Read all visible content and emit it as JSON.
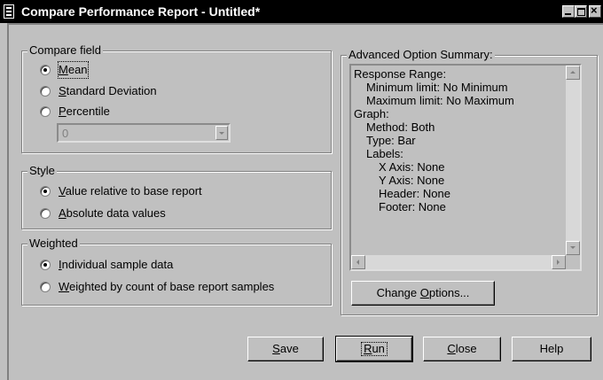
{
  "window": {
    "title": "Compare Performance Report - Untitled*"
  },
  "compare_field": {
    "legend": "Compare field",
    "options": [
      {
        "label_accel": "M",
        "label_rest": "ean",
        "selected": true
      },
      {
        "label_accel": "S",
        "label_rest": "tandard Deviation",
        "selected": false
      },
      {
        "label_accel": "P",
        "label_rest": "ercentile",
        "selected": false
      }
    ],
    "percentile_value": "0"
  },
  "style": {
    "legend": "Style",
    "options": [
      {
        "label_accel": "V",
        "label_rest": "alue relative to base report",
        "selected": true
      },
      {
        "label_accel": "A",
        "label_rest": "bsolute data values",
        "selected": false
      }
    ]
  },
  "weighted": {
    "legend": "Weighted",
    "options": [
      {
        "label_accel": "I",
        "label_rest": "ndividual sample data",
        "selected": true
      },
      {
        "label_accel": "W",
        "label_rest": "eighted by count of base report samples",
        "selected": false
      }
    ]
  },
  "summary": {
    "legend": "Advanced Option Summary:",
    "lines": [
      "Response Range:",
      "Minimum limit: No Minimum",
      "Maximum limit: No Maximum",
      "Graph:",
      "Method: Both",
      "Type: Bar",
      "Labels:",
      "X Axis: None",
      "Y Axis: None",
      "Header: None",
      "Footer: None"
    ]
  },
  "change_options": {
    "pre": "Change ",
    "accel": "O",
    "post": "ptions..."
  },
  "buttons": {
    "save": {
      "accel": "S",
      "rest": "ave"
    },
    "run": {
      "accel": "R",
      "rest": "un"
    },
    "close": {
      "accel": "C",
      "rest": "lose"
    },
    "help": {
      "label": "Help"
    }
  }
}
